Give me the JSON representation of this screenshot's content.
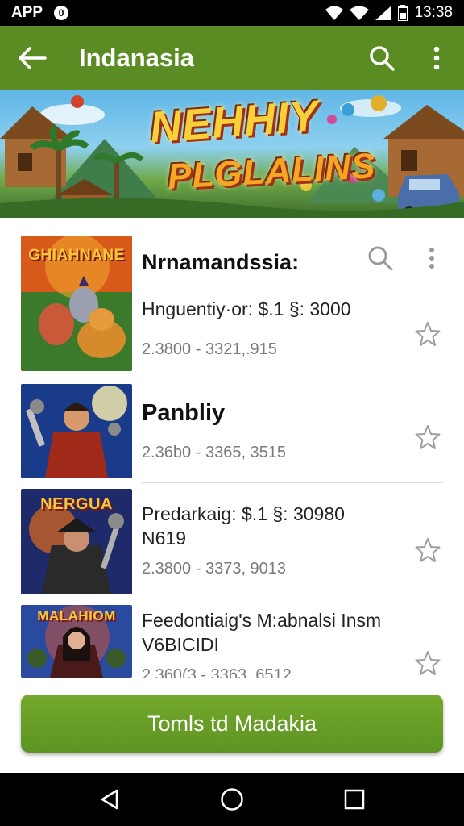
{
  "status_bar": {
    "app_label": "APP",
    "badge": "0",
    "time": "13:38"
  },
  "app_bar": {
    "title": "Indanasia",
    "icons": [
      "back-arrow-icon",
      "search-icon",
      "more-vert-icon"
    ]
  },
  "banner": {
    "line1": "NEHHIY",
    "line2": "PLGLALINS"
  },
  "items": [
    {
      "thumb_label": "GHIAHNANE",
      "name": "Nrnamandssia:",
      "subtitle": "Hnguentiy·or: $.1 §: 3000",
      "price": "2.3800 - 3321,.915",
      "favorite": false
    },
    {
      "thumb_label": "",
      "name": "Panbliy",
      "subtitle": "",
      "price": "2.36b0 - 3365, 3515",
      "favorite": false
    },
    {
      "thumb_label": "NERGUA",
      "name": "",
      "subtitle": "Predarkaig: $.1 §: 30980",
      "subtitle2": "N619",
      "price": "2.3800 - 3373, 9013",
      "favorite": false
    },
    {
      "thumb_label": "MALAHIOM",
      "name": "",
      "subtitle": "Feedontiaig's M:abnalsi Insm",
      "subtitle2": "V6BICIDI",
      "price": "2.360(3 - 3363, 6512",
      "favorite": false
    }
  ],
  "cta_label": "Tomls td Madakia",
  "colors": {
    "brand_green": "#5b8c23",
    "cta_green": "#6aa127",
    "star_outline": "#9e9e9e"
  },
  "nav_bar": {
    "icons": [
      "back-triangle-icon",
      "home-circle-icon",
      "recents-square-icon"
    ]
  }
}
